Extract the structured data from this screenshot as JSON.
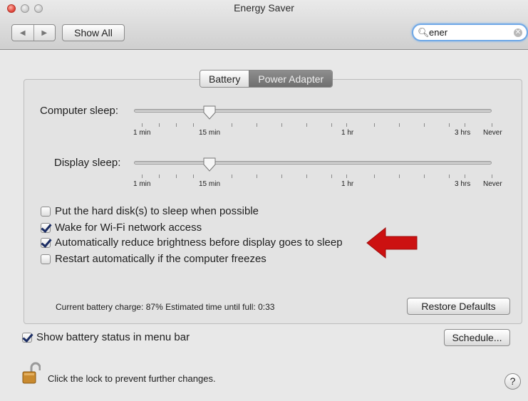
{
  "window": {
    "title": "Energy Saver"
  },
  "toolbar": {
    "back_icon": "back-arrow-icon",
    "forward_icon": "forward-arrow-icon",
    "show_all": "Show All"
  },
  "search": {
    "value": "ener"
  },
  "tabs": [
    {
      "label": "Battery",
      "selected": false
    },
    {
      "label": "Power Adapter",
      "selected": true
    }
  ],
  "sliders": {
    "computer_sleep": {
      "label": "Computer sleep:",
      "value": "15 min"
    },
    "display_sleep": {
      "label": "Display sleep:",
      "value": "15 min"
    },
    "ticks": [
      "1 min",
      "15 min",
      "1 hr",
      "3 hrs",
      "Never"
    ]
  },
  "options": [
    {
      "label": "Put the hard disk(s) to sleep when possible",
      "checked": false
    },
    {
      "label": "Wake for Wi-Fi network access",
      "checked": true
    },
    {
      "label": "Automatically reduce brightness before display goes to sleep",
      "checked": true
    },
    {
      "label": "Restart automatically if the computer freezes",
      "checked": false
    }
  ],
  "status": {
    "battery": "Current battery charge: 87%  Estimated time until full: 0:33"
  },
  "buttons": {
    "restore": "Restore Defaults",
    "schedule": "Schedule..."
  },
  "menu_bar_option": {
    "label": "Show battery status in menu bar",
    "checked": true
  },
  "lock": {
    "text": "Click the lock to prevent further changes.",
    "icon": "unlocked-padlock-icon"
  },
  "help": {
    "label": "?"
  },
  "annotation": {
    "icon": "red-arrow-icon",
    "color": "#cc1111"
  }
}
